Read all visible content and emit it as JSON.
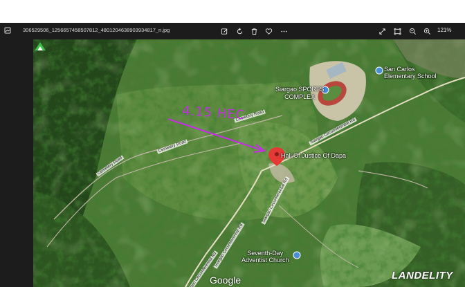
{
  "toolbar": {
    "filename": "306529506_1256657458507812_4801204638903934817_n.jpg",
    "zoom": "121%",
    "icons": [
      "file-icon",
      "edit-icon",
      "rotate-icon",
      "delete-icon",
      "favorite-icon",
      "more-icon",
      "expand-icon",
      "fit-icon",
      "zoom-out-icon",
      "zoom-in-icon"
    ]
  },
  "map": {
    "places": {
      "san_carlos": "San Carlos\nElementary School",
      "siargao_sports": "Siargao SPORTS\nCOMPLEX",
      "hall_of_justice": "Hall Of Justice Of Dapa",
      "seventh_day": "Seventh-Day\nAdventist Church"
    },
    "roads": {
      "cemetery1": "Cemetery Road",
      "cemetery2": "Cemetery Road",
      "cemetery3": "Cemetery Road",
      "circ1": "Siargao Circumferential Rd",
      "circ2": "Siargao Circumferential Rd",
      "circ3": "Siargao Circumferential Rd",
      "circ4": "Siargao Circumferential Rd"
    },
    "annotation": "4.15 HEC",
    "google": "Google",
    "watermark": "LANDELITY"
  },
  "colors": {
    "toolbar_bg": "#1c1c1c",
    "annotation": "#c030e0",
    "pin": "#e53935",
    "poi_icon": "#4a8fd6"
  }
}
